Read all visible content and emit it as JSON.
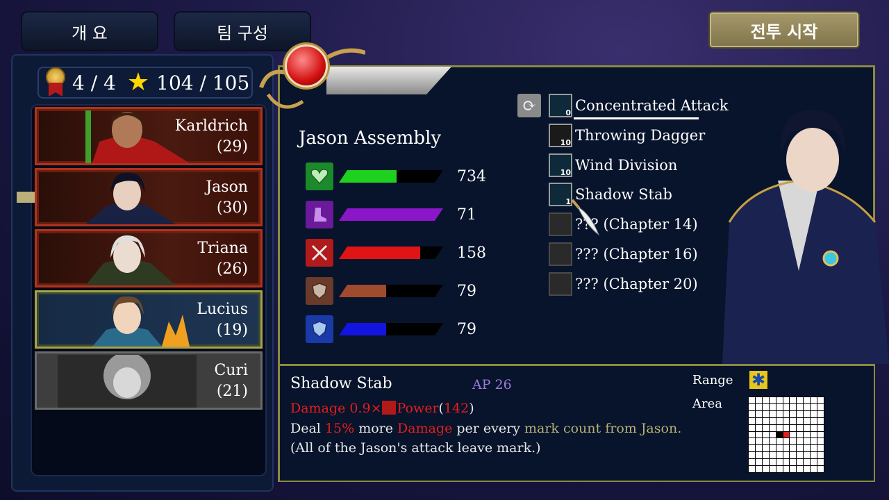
{
  "tabs": [
    {
      "label": "개 요"
    },
    {
      "label": "팀 구성"
    }
  ],
  "start_button": {
    "label": "전투 시작"
  },
  "counter": {
    "members": "4 / 4",
    "stars": "104 / 105"
  },
  "party": [
    {
      "name": "Karldrich",
      "level": "(29)",
      "frame": "red"
    },
    {
      "name": "Jason",
      "level": "(30)",
      "frame": "red",
      "selected": true
    },
    {
      "name": "Triana",
      "level": "(26)",
      "frame": "red"
    },
    {
      "name": "Lucius",
      "level": "(19)",
      "frame": "gold"
    },
    {
      "name": "Curi",
      "level": "(21)",
      "frame": "gray"
    }
  ],
  "character": {
    "name": "Jason Assembly",
    "stats": [
      {
        "icon": "heart-icon",
        "value": "734",
        "fill": 0.55,
        "color": "#1ed11e"
      },
      {
        "icon": "boot-icon",
        "value": "71",
        "fill": 1.0,
        "color": "#8a16c8"
      },
      {
        "icon": "weapon-icon",
        "value": "158",
        "fill": 0.78,
        "color": "#e01414"
      },
      {
        "icon": "shield-icon",
        "value": "79",
        "fill": 0.45,
        "color": "#a04a2e"
      },
      {
        "icon": "magic-shield-icon",
        "value": "79",
        "fill": 0.45,
        "color": "#1414e0"
      }
    ]
  },
  "skills": [
    {
      "label": "Concentrated Attack",
      "level": "0",
      "icon": "concentrated-attack-icon"
    },
    {
      "label": "Throwing Dagger",
      "level": "10",
      "icon": "throwing-dagger-icon"
    },
    {
      "label": "Wind Division",
      "level": "10",
      "icon": "wind-division-icon"
    },
    {
      "label": "Shadow Stab",
      "level": "1",
      "icon": "shadow-stab-icon"
    },
    {
      "label": "??? (Chapter 14)",
      "level": "",
      "icon": "locked-chest-icon"
    },
    {
      "label": "??? (Chapter 16)",
      "level": "",
      "icon": "locked-chest-icon"
    },
    {
      "label": "??? (Chapter 20)",
      "level": "",
      "icon": "locked-chest-icon"
    }
  ],
  "detail": {
    "title": "Shadow Stab",
    "ap": "AP 26",
    "damage_prefix": "Damage 0.9×",
    "power_label": "Power",
    "power_open": "(",
    "power_value": "142",
    "power_close": ")",
    "line2_a": "Deal ",
    "line2_pct": "15%",
    "line2_b": " more ",
    "line2_dmg": "Damage",
    "line2_c": " per every ",
    "line2_mark": "mark count from Jason.",
    "line3": "(All of the Jason's attack leave mark.)",
    "range_label": "Range",
    "area_label": "Area"
  },
  "colors": {
    "accent_gold": "#8a8a40",
    "panel": "#07142b",
    "damage_red": "#e81d1d"
  }
}
